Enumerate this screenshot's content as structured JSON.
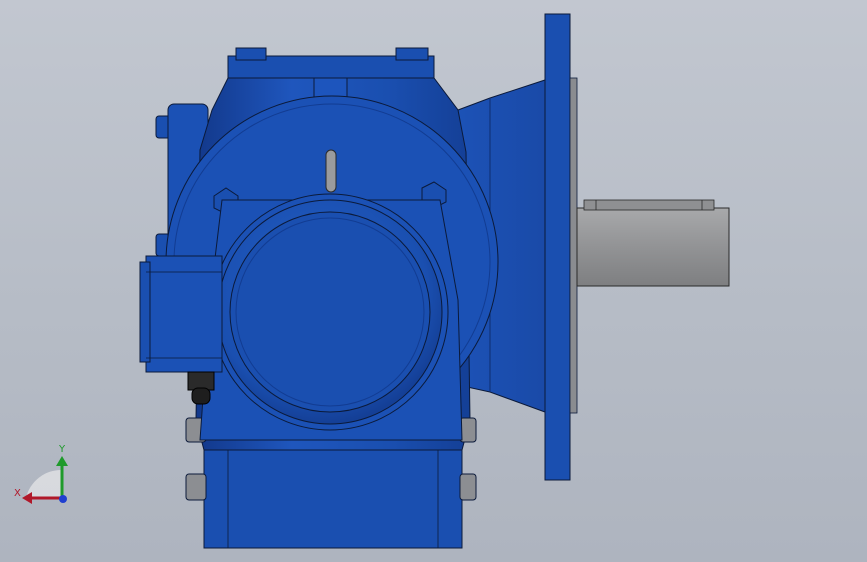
{
  "viewport": {
    "background_top": "#c2c7d0",
    "background_bottom": "#aeb4bf"
  },
  "model": {
    "body_color": "#1a4fb0",
    "body_highlight": "#2f6ad6",
    "body_shadow": "#12388a",
    "shaft_color": "#8e8f91",
    "outline_color": "#0b1a3a"
  },
  "triad": {
    "x_label": "X",
    "y_label": "Y",
    "x_color": "#b0182a",
    "y_color": "#1f9a2b",
    "z_color": "#1f3fd0",
    "icons": [
      "x-axis-arrow-icon",
      "y-axis-arrow-icon",
      "z-axis-dot-icon"
    ]
  }
}
